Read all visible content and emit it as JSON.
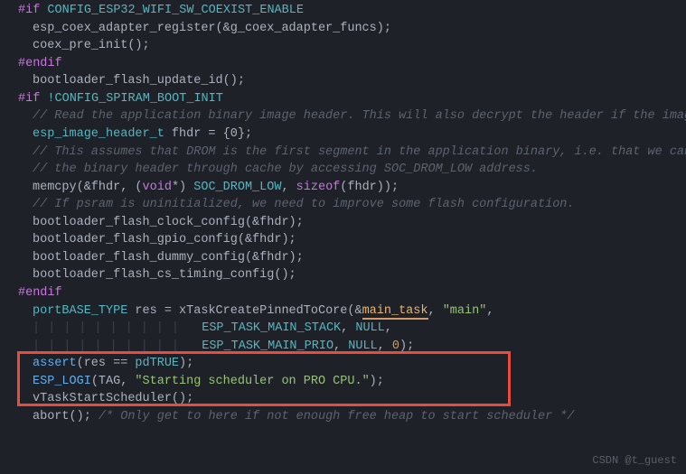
{
  "code": {
    "l1_directive": "#if",
    "l1_macro": " CONFIG_ESP32_WIFI_SW_COEXIST_ENABLE",
    "l2": "esp_coex_adapter_register(&g_coex_adapter_funcs);",
    "l3": "coex_pre_init();",
    "l4": "#endif",
    "l5": "",
    "l6": "bootloader_flash_update_id();",
    "l7_directive": "#if",
    "l7_macro": " !CONFIG_SPIRAM_BOOT_INIT",
    "l8": "// Read the application binary image header. This will also decrypt the header if the image is encrypted.",
    "l9_type": "esp_image_header_t",
    "l9_rest": " fhdr = {0};",
    "l10": "// This assumes that DROM is the first segment in the application binary, i.e. that we can read",
    "l11": "// the binary header through cache by accessing SOC_DROM_LOW address.",
    "l12_a": "memcpy(&fhdr, (",
    "l12_void": "void",
    "l12_b": "*) ",
    "l12_const": "SOC_DROM_LOW",
    "l12_c": ", ",
    "l12_sizeof": "sizeof",
    "l12_d": "(fhdr));",
    "l13": "// If psram is uninitialized, we need to improve some flash configuration.",
    "l14": "bootloader_flash_clock_config(&fhdr);",
    "l15": "bootloader_flash_gpio_config(&fhdr);",
    "l16": "bootloader_flash_dummy_config(&fhdr);",
    "l17": "bootloader_flash_cs_timing_config();",
    "l18": "#endif",
    "l19": "",
    "l20_type": "portBASE_TYPE",
    "l20_a": " res = xTaskCreatePinnedToCore(&",
    "l20_hl": "main_task",
    "l20_b": ", ",
    "l20_str": "\"main\"",
    "l20_c": ",",
    "l21_a": "ESP_TASK_MAIN_STACK",
    "l21_b": ", ",
    "l21_null": "NULL",
    "l21_c": ",",
    "l22_a": "ESP_TASK_MAIN_PRIO",
    "l22_b": ", ",
    "l22_null": "NULL",
    "l22_c": ", ",
    "l22_num": "0",
    "l22_d": ");",
    "l23_assert": "assert",
    "l23_a": "(res == ",
    "l23_pd": "pdTRUE",
    "l23_b": ");",
    "l24_a": "ESP_LOGI",
    "l24_b": "(TAG, ",
    "l24_str": "\"Starting scheduler on PRO CPU.\"",
    "l24_c": ");",
    "l25": "vTaskStartScheduler();",
    "l26_a": "abort(); ",
    "l26_comment": "/* Only get to here if not enough free heap to start scheduler */"
  },
  "watermark": "CSDN @t_guest"
}
